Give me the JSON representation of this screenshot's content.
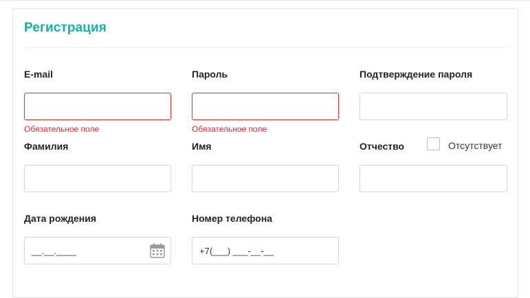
{
  "form": {
    "title": "Регистрация",
    "email": {
      "label": "E-mail",
      "value": "",
      "error": "Обязательное поле"
    },
    "password": {
      "label": "Пароль",
      "value": "",
      "error": "Обязательное поле"
    },
    "password_confirm": {
      "label": "Подтверждение пароля",
      "value": ""
    },
    "last_name": {
      "label": "Фамилия",
      "value": ""
    },
    "first_name": {
      "label": "Имя",
      "value": ""
    },
    "middle_name": {
      "label": "Отчество",
      "value": "",
      "checkbox_label": "Отсутствует",
      "checkbox_checked": false
    },
    "birth_date": {
      "label": "Дата рождения",
      "mask": "__.__.____",
      "icon": "calendar-icon"
    },
    "phone": {
      "label": "Номер телефона",
      "mask": "+7(___) ___-__-__"
    }
  },
  "colors": {
    "accent": "#12b2a4",
    "error": "#d32f2f",
    "border": "#d6d6d6"
  }
}
